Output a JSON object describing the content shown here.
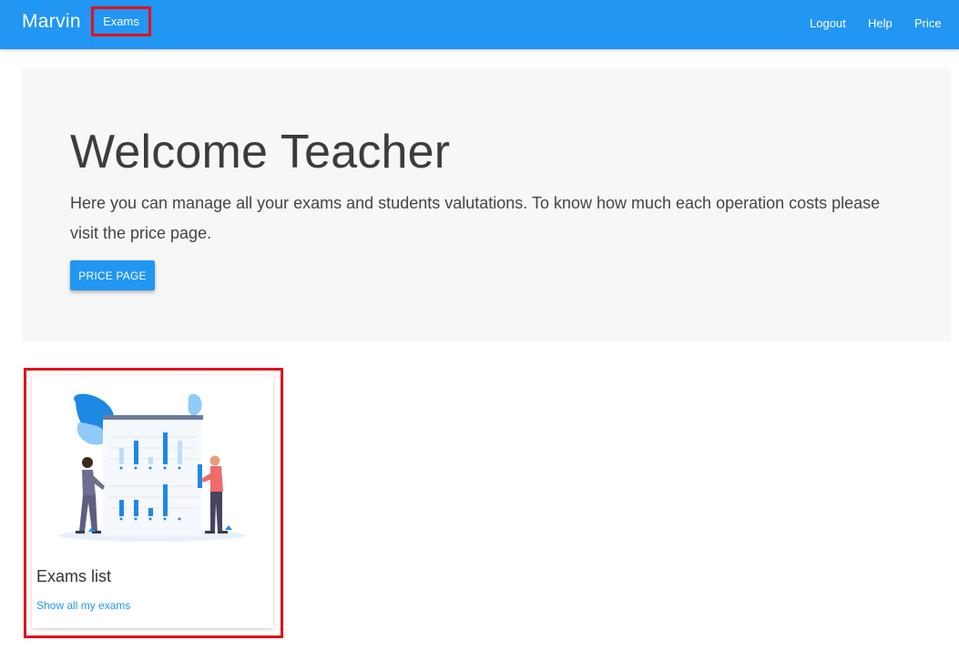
{
  "navbar": {
    "brand": "Marvin",
    "exams_link": "Exams",
    "logout_link": "Logout",
    "help_link": "Help",
    "price_link": "Price"
  },
  "jumbotron": {
    "title": "Welcome Teacher",
    "text": "Here you can manage all your exams and students valutations. To know how much each operation costs please visit the price page.",
    "button_label": "PRICE PAGE"
  },
  "card": {
    "title": "Exams list",
    "link": "Show all my exams",
    "illustration": "data-report-illustration"
  },
  "colors": {
    "primary": "#2196f3",
    "highlight": "#e3101a",
    "jumbotron_bg": "#f7f7f7"
  }
}
